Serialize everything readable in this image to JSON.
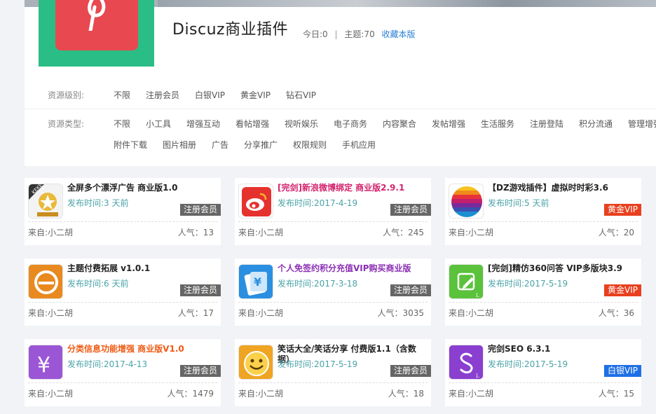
{
  "site": {
    "title": "Discuz商业插件",
    "today": "今日:0",
    "sep": "|",
    "topics": "主题:70",
    "favorite": "收藏本版"
  },
  "filters": {
    "level_label": "资源级别:",
    "levels": [
      "不限",
      "注册会员",
      "白银VIP",
      "黄金VIP",
      "钻石VIP"
    ],
    "type_label": "资源类型:",
    "types_row1": [
      "不限",
      "小工具",
      "增强互动",
      "看帖增强",
      "视听娱乐",
      "电子商务",
      "内容聚合",
      "发帖增强",
      "生活服务",
      "注册登陆",
      "积分流通",
      "管理增强"
    ],
    "types_row2": [
      "附件下载",
      "图片相册",
      "广告",
      "分享推广",
      "权限规则",
      "手机应用"
    ]
  },
  "cards": [
    {
      "title": "全屏多个漂浮广告 商业版1.0",
      "date": "发布时间:3 天前",
      "badge": "注册会员",
      "from": "来自:小二胡",
      "pop": "人气：13",
      "icon": "keke-icon"
    },
    {
      "title": "[完剑]新浪微博绑定 商业版2.9.1",
      "date": "发布时间:2017-4-19",
      "badge": "注册会员",
      "from": "来自:小二胡",
      "pop": "人气：245",
      "icon": "weibo-icon"
    },
    {
      "title": "【DZ游戏插件】虚拟时时彩3.6",
      "date": "发布时间:5 天前",
      "badge": "黄金VIP",
      "from": "来自:小二胡",
      "pop": "人气：20",
      "icon": "lottery-ball-icon"
    },
    {
      "title": "主题付费拓展 v1.0.1",
      "date": "发布时间:6 天前",
      "badge": "注册会员",
      "from": "来自:小二胡",
      "pop": "人气：17",
      "icon": "coin-icon"
    },
    {
      "title": "个人免签约积分充值VIP购买商业版",
      "date": "发布时间:2017-3-18",
      "badge": "注册会员",
      "from": "来自:小二胡",
      "pop": "人气：3035",
      "icon": "yen-card-icon"
    },
    {
      "title": "[完剑]精仿360问答 VIP多版块3.9",
      "date": "发布时间:2017-5-19",
      "badge": "黄金VIP",
      "from": "来自:小二胡",
      "pop": "人气：36",
      "icon": "edit-icon"
    },
    {
      "title": "分类信息功能增强 商业版V1.0",
      "date": "发布时间:2017-4-13",
      "badge": "注册会员",
      "from": "来自:小二胡",
      "pop": "人气：1479",
      "icon": "yen-icon"
    },
    {
      "title": "笑话大全/笑话分享 付费版1.1（含数据）",
      "date": "发布时间:2017-5-19",
      "badge": "注册会员",
      "from": "来自:小二胡",
      "pop": "人气：18",
      "icon": "smiley-icon"
    },
    {
      "title": "完剑SEO 6.3.1",
      "date": "发布时间:2017-5-19",
      "badge": "白银VIP",
      "from": "来自:小二胡",
      "pop": "人气：15",
      "icon": "seo-s-icon"
    }
  ],
  "colors": {
    "gold_badge": "#e8401f",
    "silver_badge": "#1f70e6",
    "member_badge": "#666666",
    "date_text": "#4aa3a8"
  }
}
